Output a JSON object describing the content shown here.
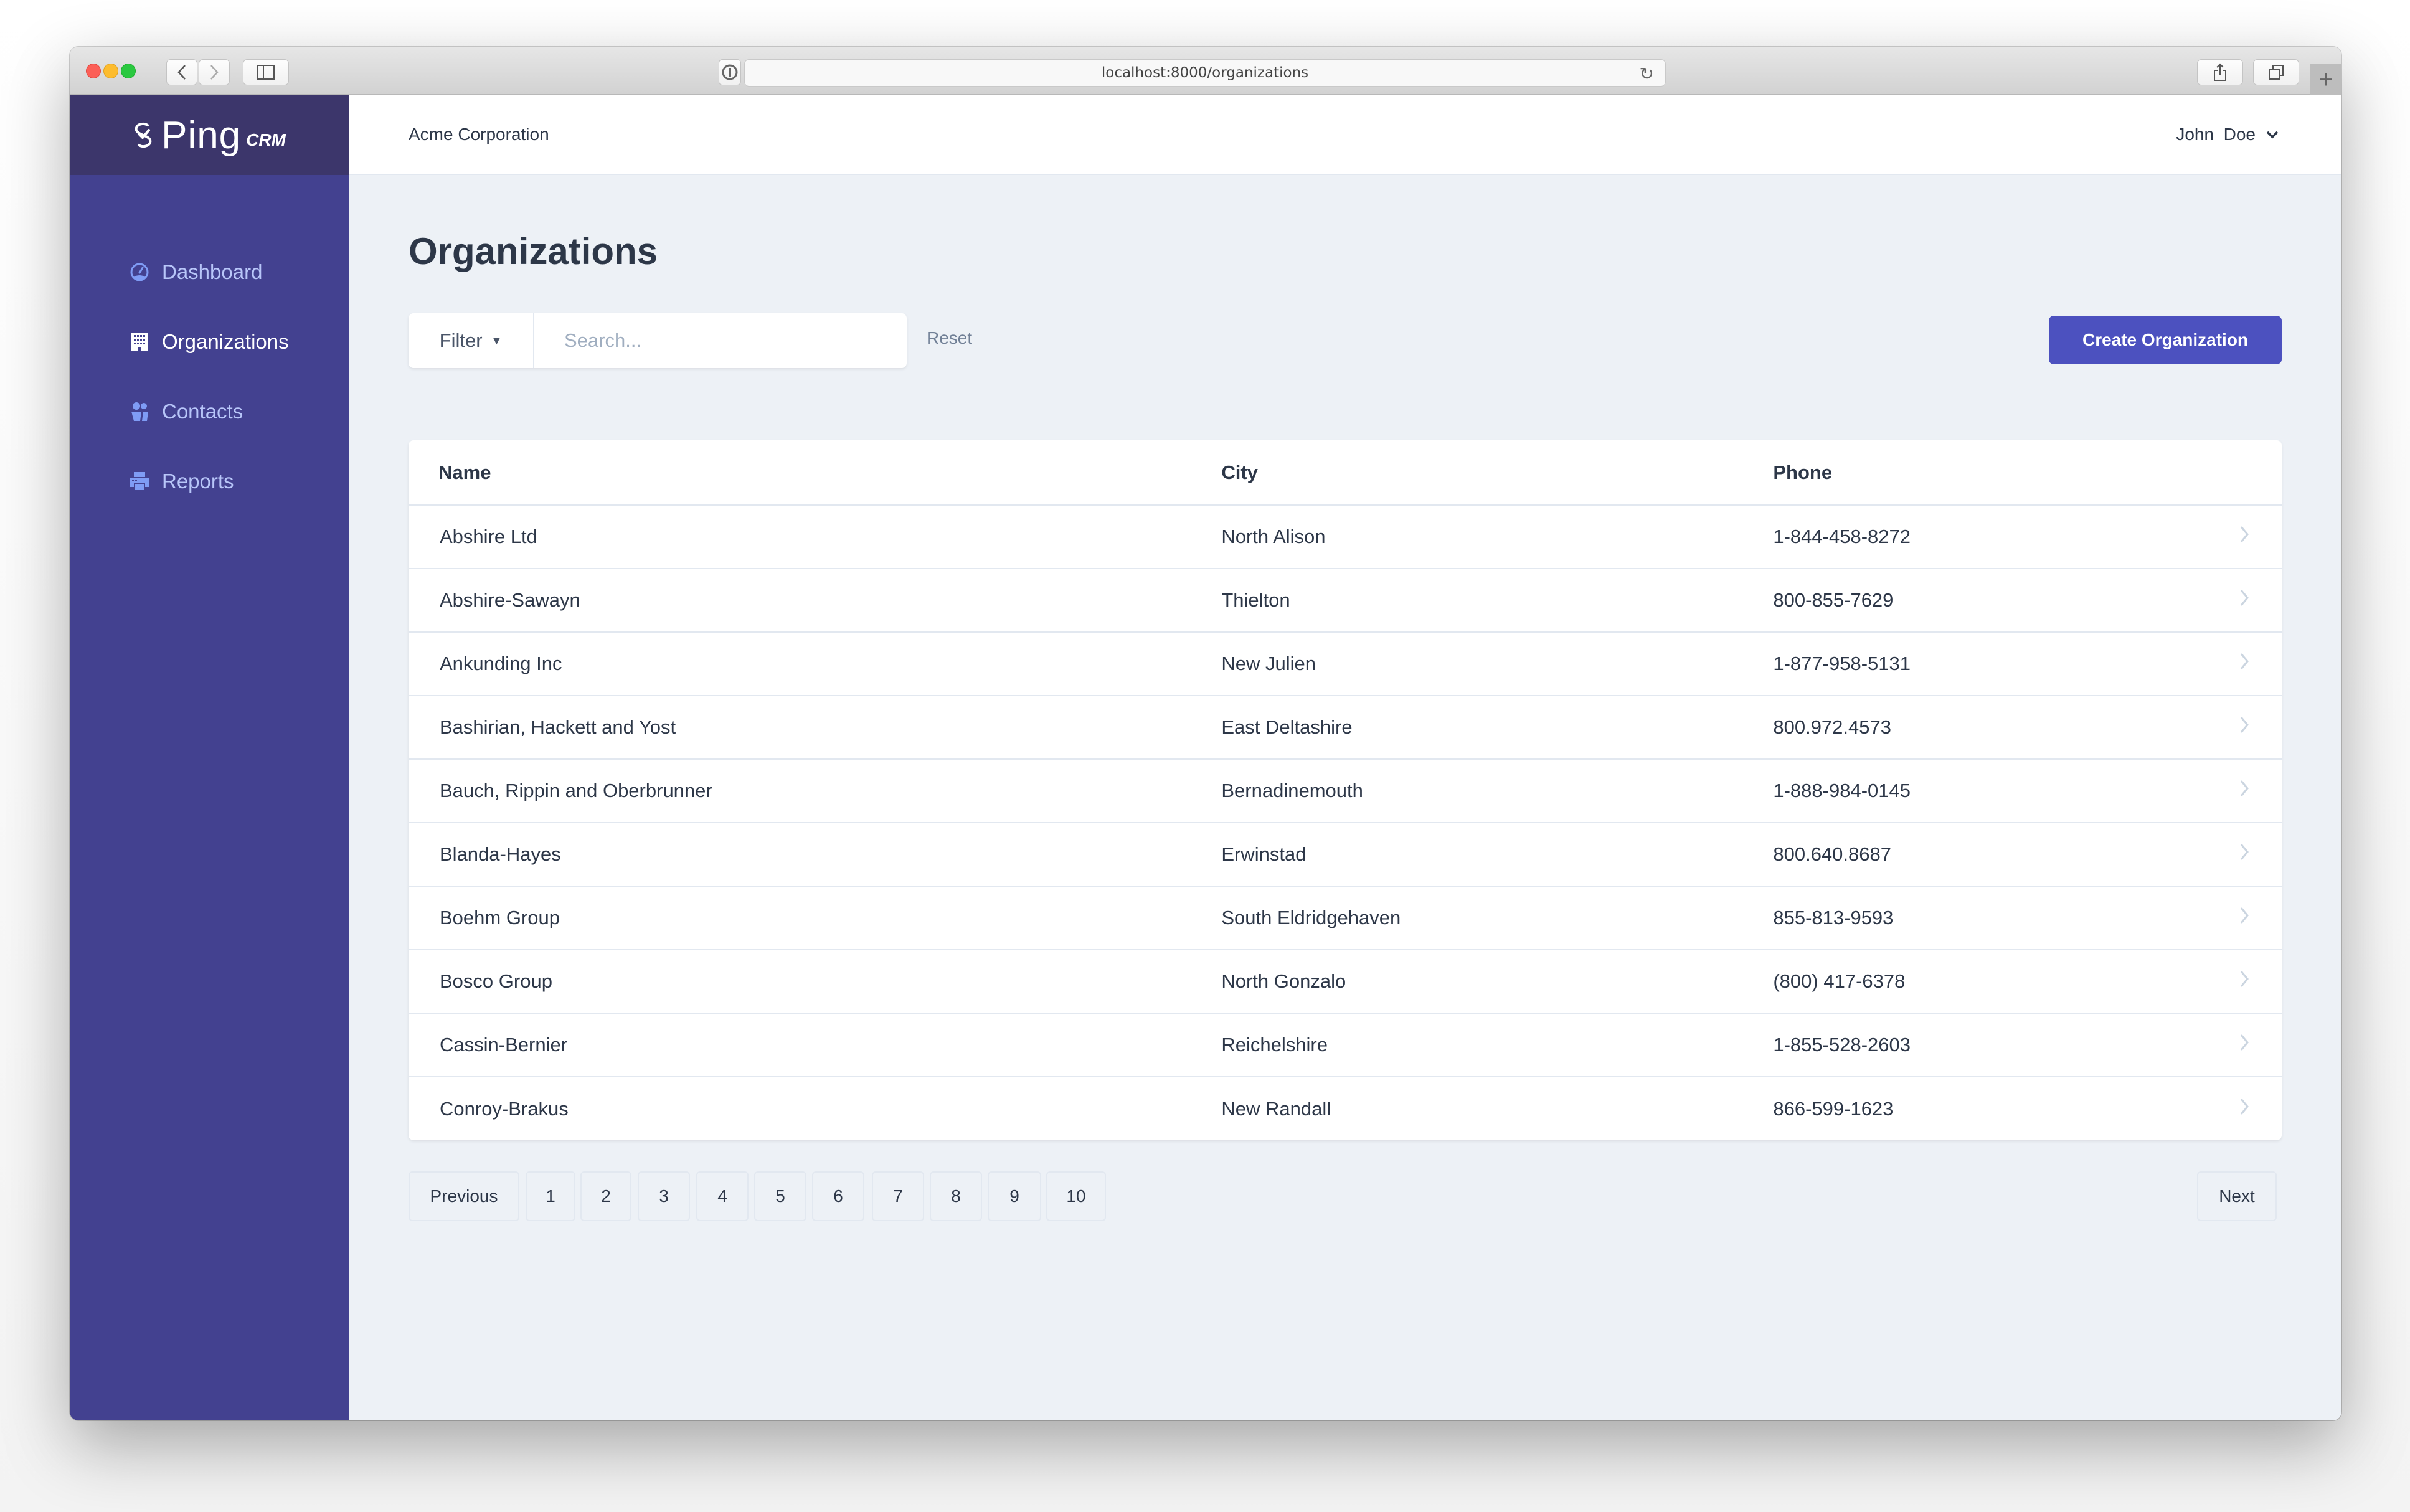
{
  "browser": {
    "url": "localhost:8000/organizations"
  },
  "app": {
    "logo": {
      "name": "Ping",
      "suffix": "CRM"
    },
    "company": "Acme Corporation",
    "user": "John  Doe"
  },
  "sidebar": {
    "items": [
      {
        "label": "Dashboard",
        "icon": "dashboard-gauge-icon",
        "active": false
      },
      {
        "label": "Organizations",
        "icon": "office-building-icon",
        "active": true
      },
      {
        "label": "Contacts",
        "icon": "users-icon",
        "active": false
      },
      {
        "label": "Reports",
        "icon": "printer-icon",
        "active": false
      }
    ]
  },
  "page": {
    "title": "Organizations",
    "filter_label": "Filter",
    "search_placeholder": "Search...",
    "search_value": "",
    "reset_label": "Reset",
    "create_label": "Create Organization"
  },
  "table": {
    "columns": [
      "Name",
      "City",
      "Phone"
    ],
    "rows": [
      {
        "name": "Abshire Ltd",
        "city": "North Alison",
        "phone": "1-844-458-8272"
      },
      {
        "name": "Abshire-Sawayn",
        "city": "Thielton",
        "phone": "800-855-7629"
      },
      {
        "name": "Ankunding Inc",
        "city": "New Julien",
        "phone": "1-877-958-5131"
      },
      {
        "name": "Bashirian, Hackett and Yost",
        "city": "East Deltashire",
        "phone": "800.972.4573"
      },
      {
        "name": "Bauch, Rippin and Oberbrunner",
        "city": "Bernadinemouth",
        "phone": "1-888-984-0145"
      },
      {
        "name": "Blanda-Hayes",
        "city": "Erwinstad",
        "phone": "800.640.8687"
      },
      {
        "name": "Boehm Group",
        "city": "South Eldridgehaven",
        "phone": "855-813-9593"
      },
      {
        "name": "Bosco Group",
        "city": "North Gonzalo",
        "phone": "(800) 417-6378"
      },
      {
        "name": "Cassin-Bernier",
        "city": "Reichelshire",
        "phone": "1-855-528-2603"
      },
      {
        "name": "Conroy-Brakus",
        "city": "New Randall",
        "phone": "866-599-1623"
      }
    ]
  },
  "pagination": {
    "previous": "Previous",
    "pages": [
      "1",
      "2",
      "3",
      "4",
      "5",
      "6",
      "7",
      "8",
      "9",
      "10"
    ],
    "next": "Next"
  },
  "colors": {
    "sidebar": "#434190",
    "logo_bg": "#3c366b",
    "accent": "#4c51bf",
    "page_bg": "#edf1f6"
  }
}
